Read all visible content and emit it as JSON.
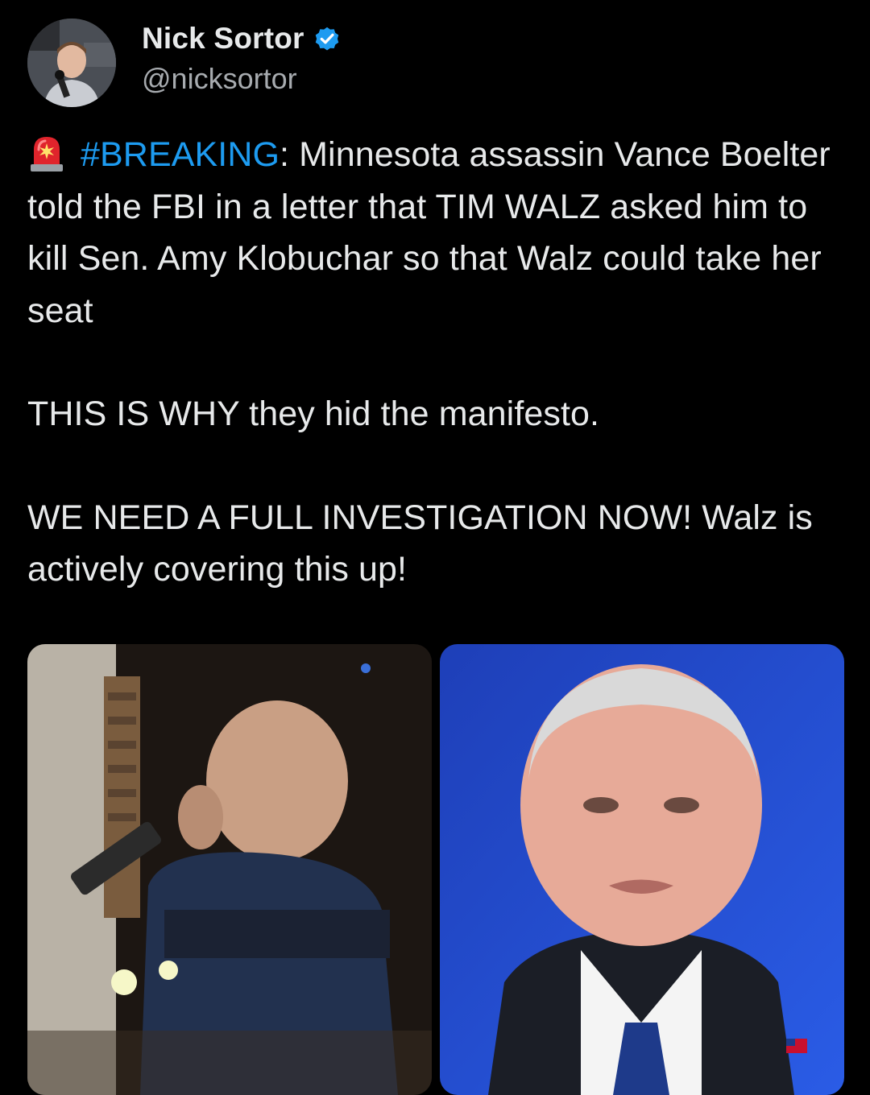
{
  "author": {
    "display_name": "Nick Sortor",
    "handle": "@nicksortor",
    "verified": true,
    "avatar_icon": "profile-photo",
    "verified_icon": "verified-badge-icon"
  },
  "tweet": {
    "emoji_icon": "police-siren-icon",
    "hashtag": "#BREAKING",
    "line1_rest": ": Minnesota assassin Vance Boelter told the FBI in a letter that TIM WALZ asked him to kill Sen. Amy Klobuchar so that Walz could take her seat",
    "paragraph2": "THIS IS WHY they hid the manifesto.",
    "paragraph3": "WE NEED A FULL INVESTIGATION NOW! Walz is actively covering this up!"
  },
  "media": [
    {
      "name": "masked-man-photo",
      "description_icon": "photo-left"
    },
    {
      "name": "walz-photo",
      "description_icon": "photo-right"
    }
  ],
  "colors": {
    "background": "#000000",
    "text": "#e7e9ea",
    "handle": "#a7abaf",
    "link": "#1d9bf0",
    "verified": "#1d9bf0"
  }
}
